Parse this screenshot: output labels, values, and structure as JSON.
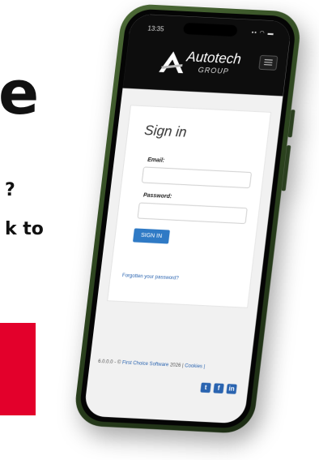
{
  "background": {
    "headline_fragment": "e",
    "line1_fragment": "?",
    "line2_fragment": "k to",
    "accent_color": "#e3002b"
  },
  "phone": {
    "frame_color": "#3a5528",
    "status": {
      "time": "13:35",
      "icons": "▪▪ ◠ ▬"
    },
    "header": {
      "logo_icon": "autotech-logo-icon",
      "brand": "Autotech",
      "brand_sub": "GROUP",
      "menu_icon": "menu-icon"
    },
    "signin": {
      "title": "Sign in",
      "email_label": "Email:",
      "email_value": "",
      "password_label": "Password:",
      "password_value": "",
      "button_label": "SIGN IN",
      "forgot_link": "Forgotten your password?"
    },
    "footer": {
      "version": "6.0.0.0 - ©",
      "company_link": "First Choice Software",
      "year": "2026 |",
      "cookies_link": "Cookies |",
      "socials": [
        {
          "icon": "twitter-icon",
          "glyph": "t"
        },
        {
          "icon": "facebook-icon",
          "glyph": "f"
        },
        {
          "icon": "linkedin-icon",
          "glyph": "in"
        }
      ]
    },
    "link_color": "#2a64b0",
    "button_color": "#2f7ac5"
  }
}
